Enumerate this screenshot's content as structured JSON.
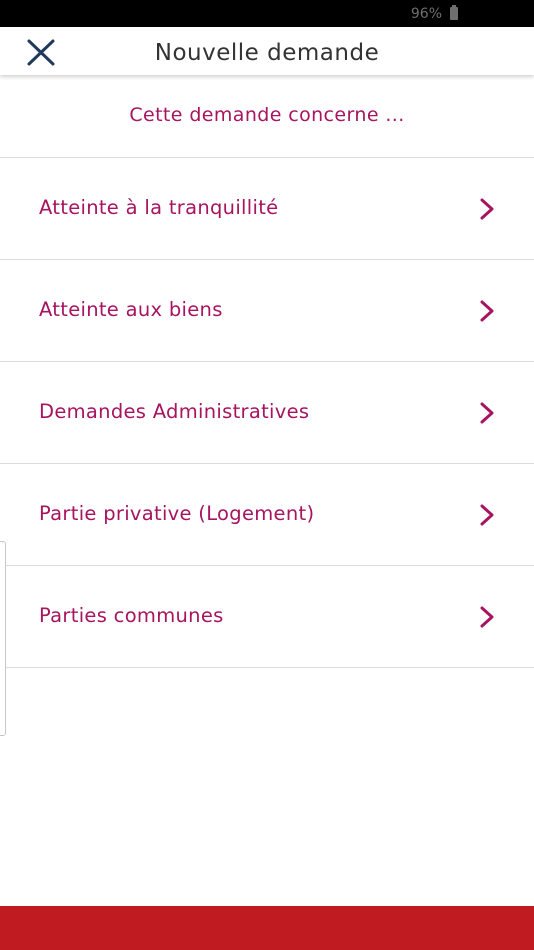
{
  "status_bar": {
    "battery_level": "96%"
  },
  "header": {
    "title": "Nouvelle demande"
  },
  "subtitle": "Cette demande concerne ...",
  "categories": [
    {
      "label": "Atteinte à la tranquillité"
    },
    {
      "label": "Atteinte aux biens"
    },
    {
      "label": "Demandes Administratives"
    },
    {
      "label": "Partie privative (Logement)"
    },
    {
      "label": "Parties communes"
    }
  ],
  "colors": {
    "accent": "#a7145f",
    "footer": "#bf1b21",
    "close_icon": "#1f3a5c"
  }
}
